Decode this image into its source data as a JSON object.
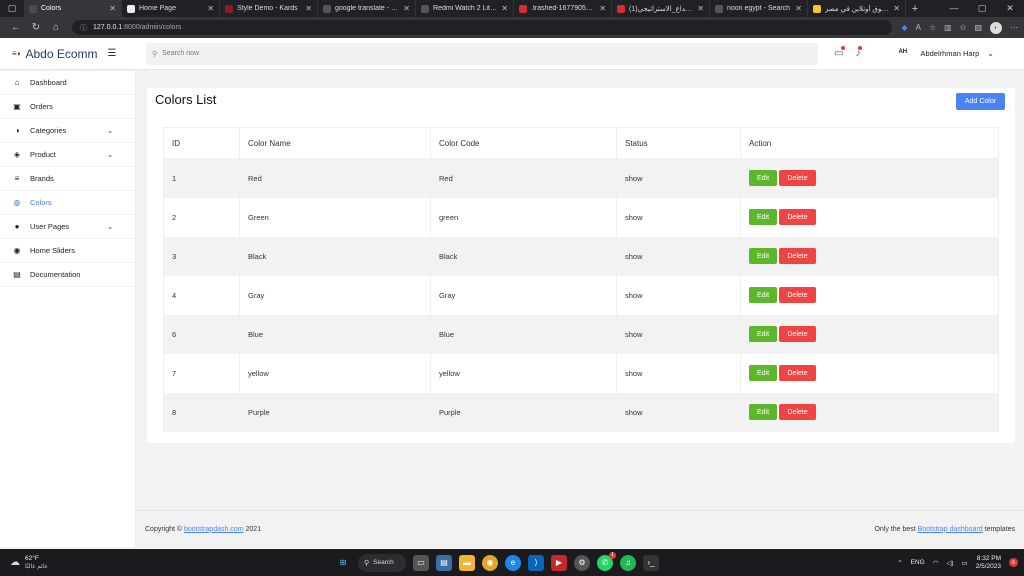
{
  "browser": {
    "tabs": [
      {
        "title": "Colors",
        "active": true,
        "color": "#4b4b4b"
      },
      {
        "title": "Home Page",
        "active": false,
        "color": "#eeeeee"
      },
      {
        "title": "Style Demo - Kards",
        "active": false,
        "color": "#8b1a2b"
      },
      {
        "title": "google translate - Sear",
        "active": false,
        "color": "#555555"
      },
      {
        "title": "Redmi Watch 2 Lite SM",
        "active": false,
        "color": "#555555"
      },
      {
        "title": ".trashed-1677905930-…",
        "active": false,
        "color": "#d32f2f"
      },
      {
        "title": "الخداع_الاستراتيجي(1).pdf",
        "active": false,
        "color": "#d32f2f"
      },
      {
        "title": "noon egypt - Search",
        "active": false,
        "color": "#555555"
      },
      {
        "title": "التسوق أونلاين في مصر",
        "active": false,
        "color": "#f6c33b"
      }
    ],
    "url_host": "127.0.0.1",
    "url_path": ":8000/admin/colors"
  },
  "header": {
    "brand": "Abdo Ecomm",
    "search_placeholder": "Search now",
    "user_name": "Abdelrhman Harp",
    "user_avatar_text": "AH"
  },
  "sidebar": {
    "items": [
      {
        "label": "Dashboard",
        "icon": "home-icon",
        "glyph": "⌂",
        "chevron": false,
        "active": false
      },
      {
        "label": "Orders",
        "icon": "orders-icon",
        "glyph": "▣",
        "chevron": false,
        "active": false
      },
      {
        "label": "Categories",
        "icon": "categories-icon",
        "glyph": "◑",
        "chevron": true,
        "active": false
      },
      {
        "label": "Product",
        "icon": "product-icon",
        "glyph": "◈",
        "chevron": true,
        "active": false
      },
      {
        "label": "Brands",
        "icon": "brands-icon",
        "glyph": "≡",
        "chevron": false,
        "active": false
      },
      {
        "label": "Colors",
        "icon": "palette-icon",
        "glyph": "◍",
        "chevron": false,
        "active": true
      },
      {
        "label": "User Pages",
        "icon": "user-icon",
        "glyph": "●",
        "chevron": true,
        "active": false
      },
      {
        "label": "Home Sliders",
        "icon": "sliders-icon",
        "glyph": "◉",
        "chevron": false,
        "active": false
      },
      {
        "label": "Documentation",
        "icon": "documentation-icon",
        "glyph": "▤",
        "chevron": false,
        "active": false
      }
    ]
  },
  "main": {
    "title": "Colors List",
    "add_button": "Add Color",
    "columns": [
      "ID",
      "Color Name",
      "Color Code",
      "Status",
      "Action"
    ],
    "rows": [
      {
        "id": "1",
        "name": "Red",
        "code": "Red",
        "status": "show"
      },
      {
        "id": "2",
        "name": "Green",
        "code": "green",
        "status": "show"
      },
      {
        "id": "3",
        "name": "Black",
        "code": "Black",
        "status": "show"
      },
      {
        "id": "4",
        "name": "Gray",
        "code": "Gray",
        "status": "show"
      },
      {
        "id": "6",
        "name": "Blue",
        "code": "Blue",
        "status": "show"
      },
      {
        "id": "7",
        "name": "yellow",
        "code": "yellow",
        "status": "show"
      },
      {
        "id": "8",
        "name": "Purple",
        "code": "Purple",
        "status": "show"
      }
    ],
    "edit_label": "Edit",
    "delete_label": "Delete"
  },
  "footer": {
    "copyright_prefix": "Copyright ©",
    "copyright_link": "bootstrapdash.com",
    "copyright_year": "2021",
    "right_prefix": "Only the best",
    "right_link": "Bootstrap dashboard",
    "right_suffix": "templates"
  },
  "taskbar": {
    "temperature": "62°F",
    "weather_text": "غائم غالبًا",
    "search_label": "Search",
    "language": "ENG",
    "time": "8:32 PM",
    "date": "2/5/2023",
    "notification_count": "6",
    "whatsapp_badge": "1"
  },
  "colors": {
    "accent": "#4b83f3",
    "edit": "#5cb82a",
    "delete": "#ef4444",
    "active_nav": "#4b7bec"
  }
}
